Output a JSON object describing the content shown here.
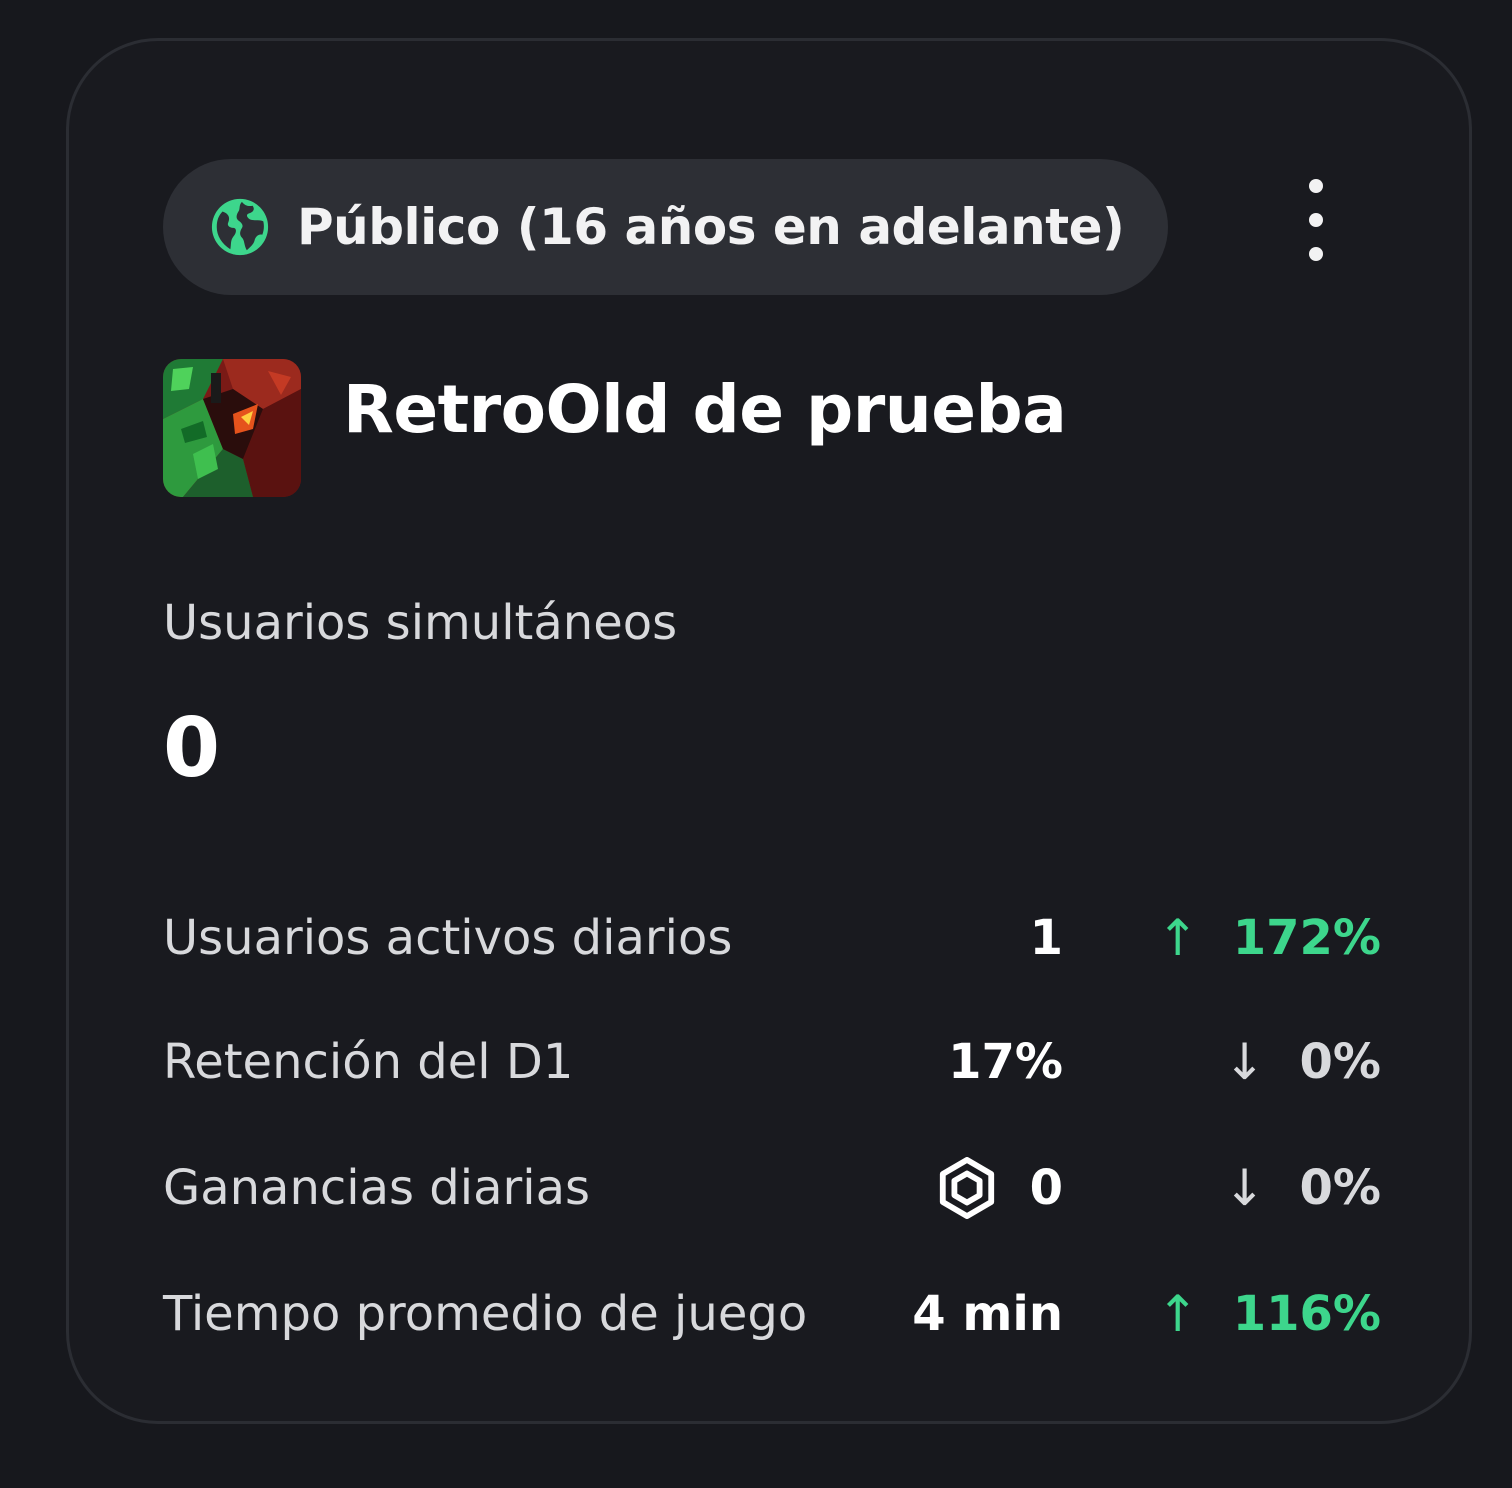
{
  "badge": {
    "label": "Público (16 años en adelante)",
    "icon": "globe-icon",
    "icon_color": "#3dd68c"
  },
  "menu": {
    "icon": "more-vertical-icon"
  },
  "experience": {
    "title": "RetroOld de prueba",
    "thumbnail": "experience-thumbnail"
  },
  "concurrent": {
    "label": "Usuarios simultáneos",
    "value": "0"
  },
  "metrics": [
    {
      "label": "Usuarios activos diarios",
      "value": "1",
      "arrow": "↑",
      "change": "172%",
      "trend": "up"
    },
    {
      "label": "Retención del D1",
      "value": "17%",
      "arrow": "↓",
      "change": "0%",
      "trend": "down"
    },
    {
      "label": "Ganancias diarias",
      "value": "0",
      "value_icon": "robux-icon",
      "arrow": "↓",
      "change": "0%",
      "trend": "down"
    },
    {
      "label": "Tiempo promedio de juego",
      "value": "4 min",
      "arrow": "↑",
      "change": "116%",
      "trend": "up"
    }
  ],
  "colors": {
    "background": "#17181d",
    "card": "#191a1f",
    "positive": "#3dd68c",
    "neutral": "#d8d9dc"
  }
}
